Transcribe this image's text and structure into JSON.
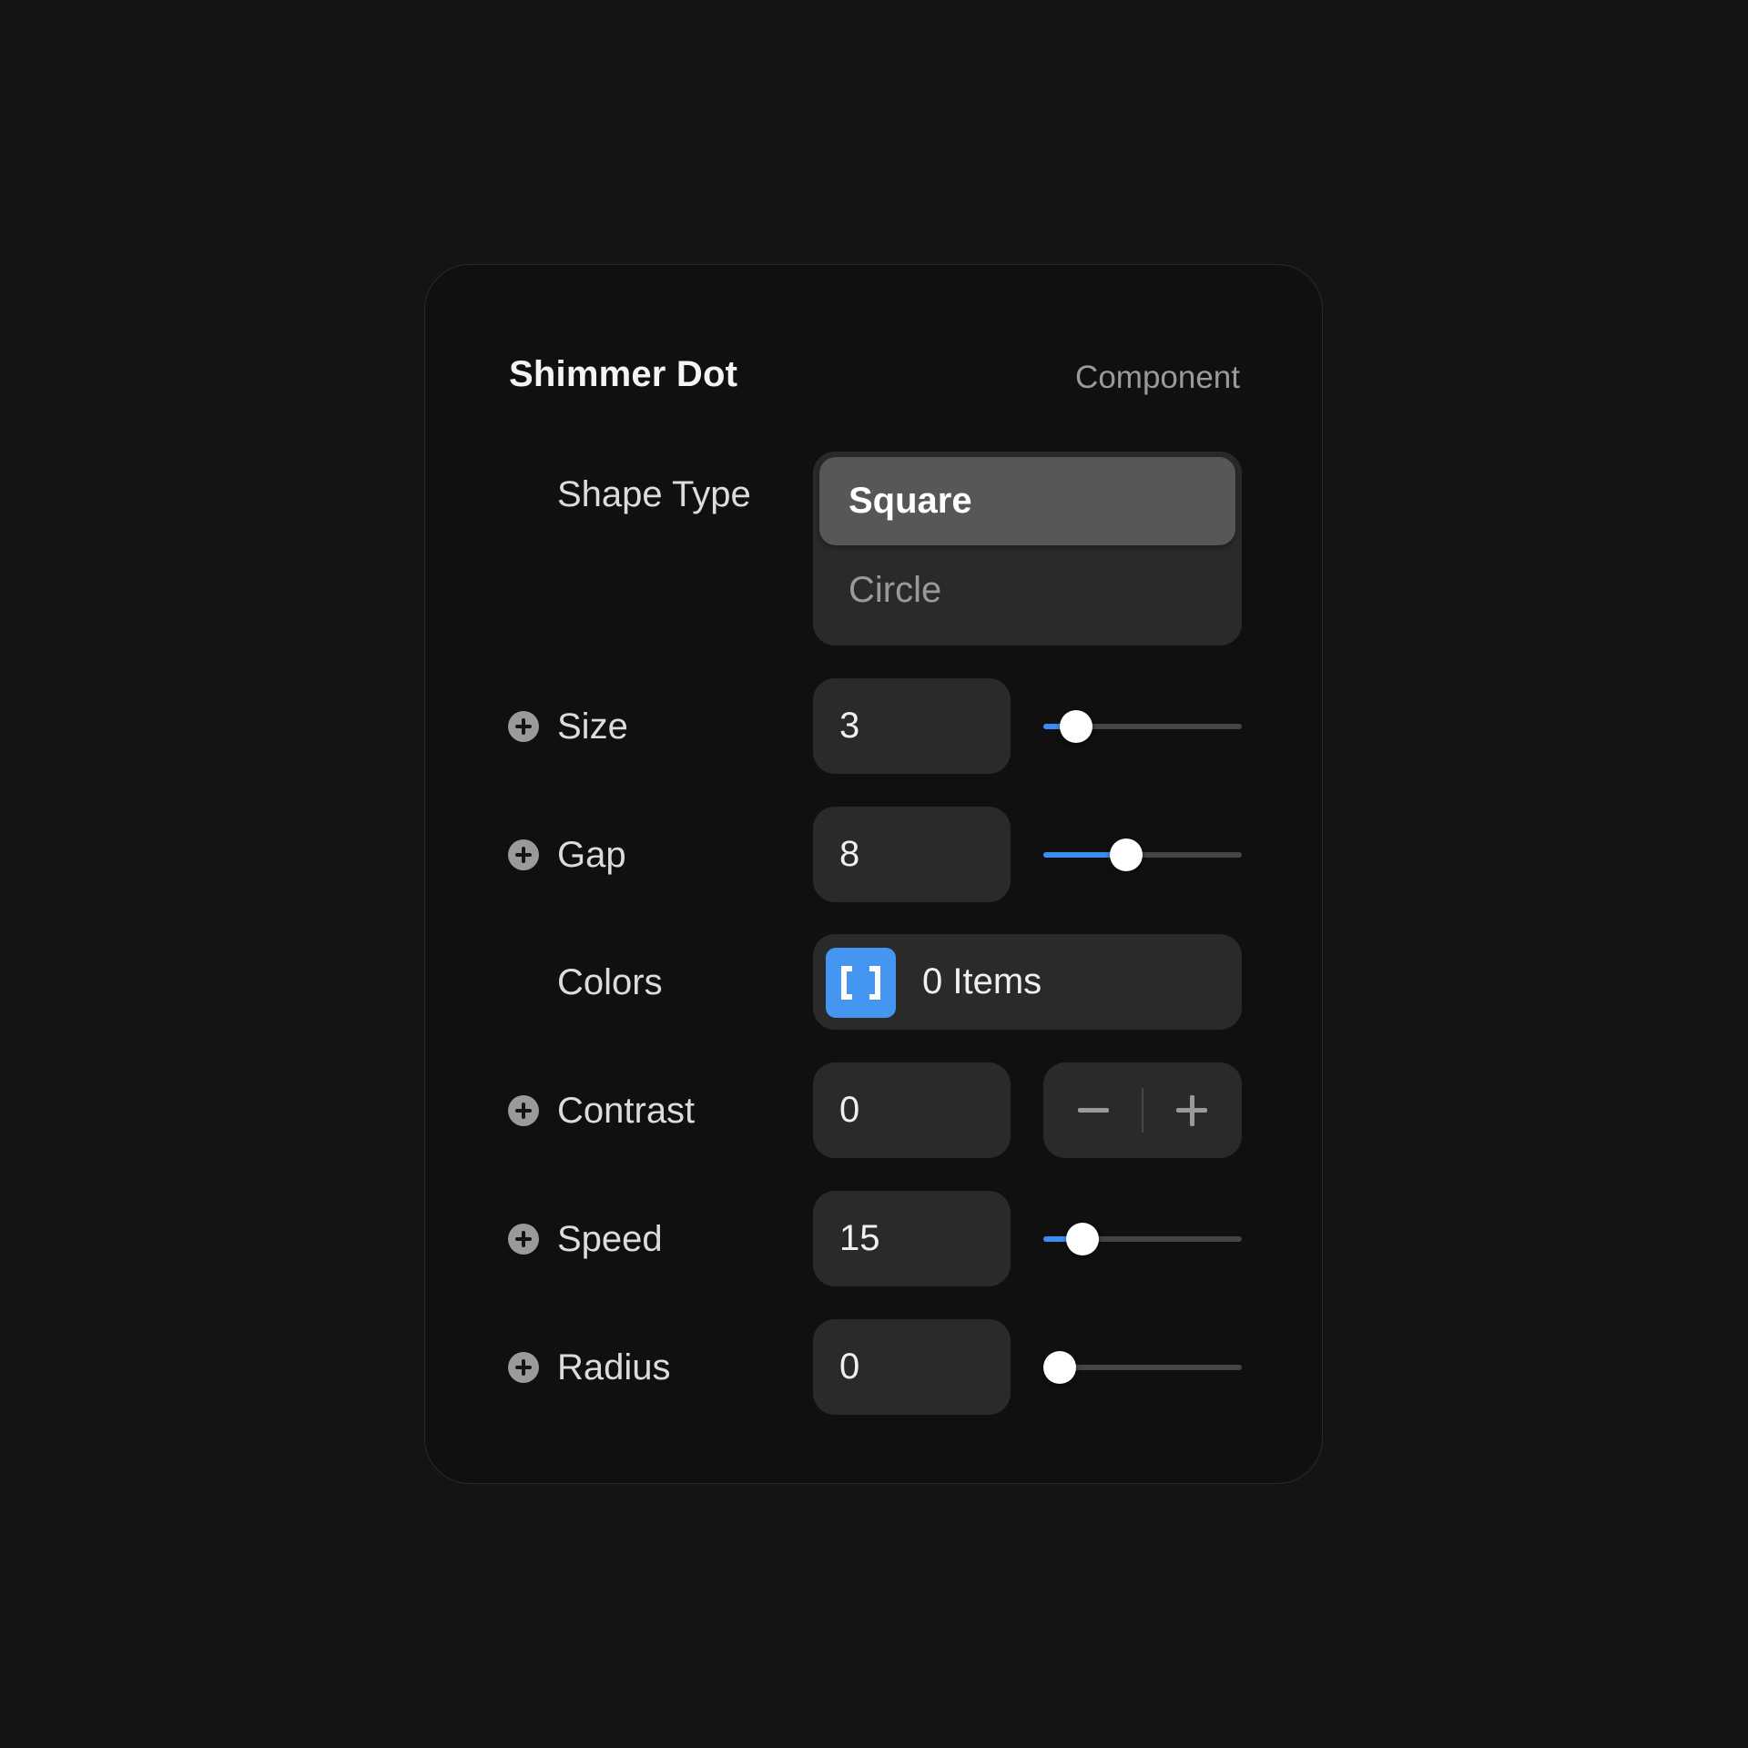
{
  "panel": {
    "title": "Shimmer Dot",
    "subtitle": "Component"
  },
  "shape_type": {
    "label": "Shape Type",
    "options": [
      "Square",
      "Circle"
    ],
    "selected": "Square"
  },
  "controls": {
    "size": {
      "label": "Size",
      "value": "3",
      "slider_fraction": 0.1
    },
    "gap": {
      "label": "Gap",
      "value": "8",
      "slider_fraction": 0.4
    },
    "colors": {
      "label": "Colors",
      "value": "0 Items",
      "icon": "array-brackets-icon"
    },
    "contrast": {
      "label": "Contrast",
      "value": "0",
      "decrement_icon": "minus-icon",
      "increment_icon": "plus-icon"
    },
    "speed": {
      "label": "Speed",
      "value": "15",
      "slider_fraction": 0.14
    },
    "radius": {
      "label": "Radius",
      "value": "0",
      "slider_fraction": 0.0
    }
  },
  "icons": {
    "row_prefix": "plus-circle-icon"
  },
  "colors": {
    "accent": "#3b8ef0",
    "array_badge": "#4496f0",
    "background": "#131416",
    "panel": "#101010",
    "field": "#2a2a2a",
    "selected_option": "#575757"
  }
}
